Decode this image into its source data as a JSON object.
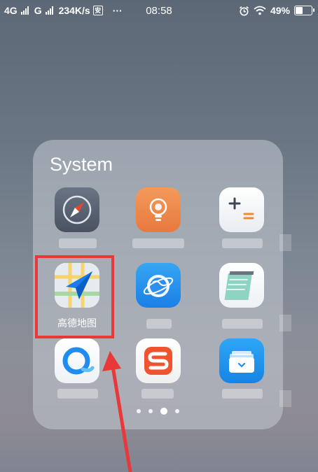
{
  "status_bar": {
    "network_1": "4G",
    "network_2": "G",
    "speed": "234K/s",
    "extra_icon": "安",
    "more": "···",
    "time": "08:58",
    "battery": "49%",
    "battery_level": 0.49
  },
  "folder": {
    "title": "System",
    "apps": [
      {
        "icon": "compass-icon",
        "label": ""
      },
      {
        "icon": "tips-bulb-icon",
        "label": ""
      },
      {
        "icon": "calculator-icon",
        "label": ""
      },
      {
        "icon": "amap-navigation-icon",
        "label": "高德地图"
      },
      {
        "icon": "browser-globe-icon",
        "label": ""
      },
      {
        "icon": "notes-icon",
        "label": ""
      },
      {
        "icon": "qq-browser-icon",
        "label": ""
      },
      {
        "icon": "sogou-input-icon",
        "label": ""
      },
      {
        "icon": "wallet-icon",
        "label": ""
      }
    ],
    "page_count": 4,
    "active_page": 3
  },
  "annotation": {
    "highlight_color": "#e8393a"
  }
}
